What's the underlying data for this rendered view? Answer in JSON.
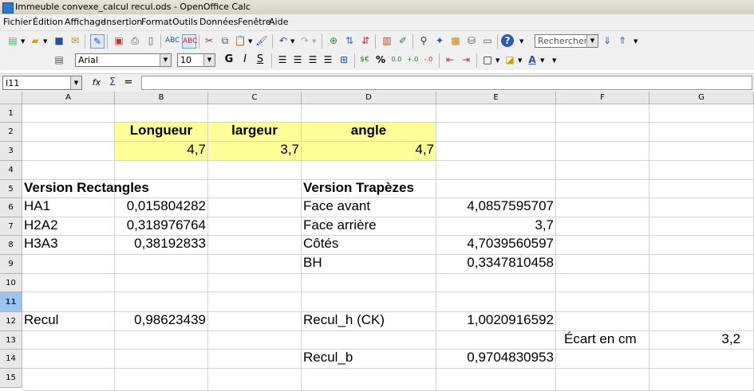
{
  "window": {
    "title": "Immeuble convexe_calcul recul.ods - OpenOffice Calc"
  },
  "menu": [
    "Fichier",
    "Édition",
    "Affichage",
    "Insertion",
    "Format",
    "Outils",
    "Données",
    "Fenêtre",
    "Aide"
  ],
  "toolbar": {
    "search_placeholder": "Rechercher"
  },
  "format_toolbar": {
    "font_name": "Arial",
    "font_size": "10"
  },
  "formula_bar": {
    "cell_ref": "I11",
    "content": ""
  },
  "columns": [
    "A",
    "B",
    "C",
    "D",
    "E",
    "F",
    "G"
  ],
  "rows": [
    "1",
    "2",
    "3",
    "4",
    "5",
    "6",
    "7",
    "8",
    "9",
    "10",
    "11",
    "12",
    "13",
    "14",
    "15"
  ],
  "selected_row": "11",
  "highlight_color": "#ffff99",
  "cells": {
    "B2": "Longueur",
    "C2": "largeur",
    "D2": "angle",
    "B3": "4,7",
    "C3": "3,7",
    "D3": "4,7",
    "A5": "Version Rectangles",
    "D5": "Version Trapèzes",
    "A6": "HA1",
    "B6": "0,015804282",
    "D6": "Face avant",
    "E6": "4,0857595707",
    "A7": "H2A2",
    "B7": "0,318976764",
    "D7": "Face arrière",
    "E7": "3,7",
    "A8": "H3A3",
    "B8": "0,38192833",
    "D8": "Côtés",
    "E8": "4,7039560597",
    "D9": "BH",
    "E9": "0,3347810458",
    "A12": "Recul",
    "B12": "0,98623439",
    "D12": "Recul_h (CK)",
    "E12": "1,0020916592",
    "F13": "Écart en cm",
    "G13": "3,2",
    "D14": "Recul_b",
    "E14": "0,9704830953"
  }
}
